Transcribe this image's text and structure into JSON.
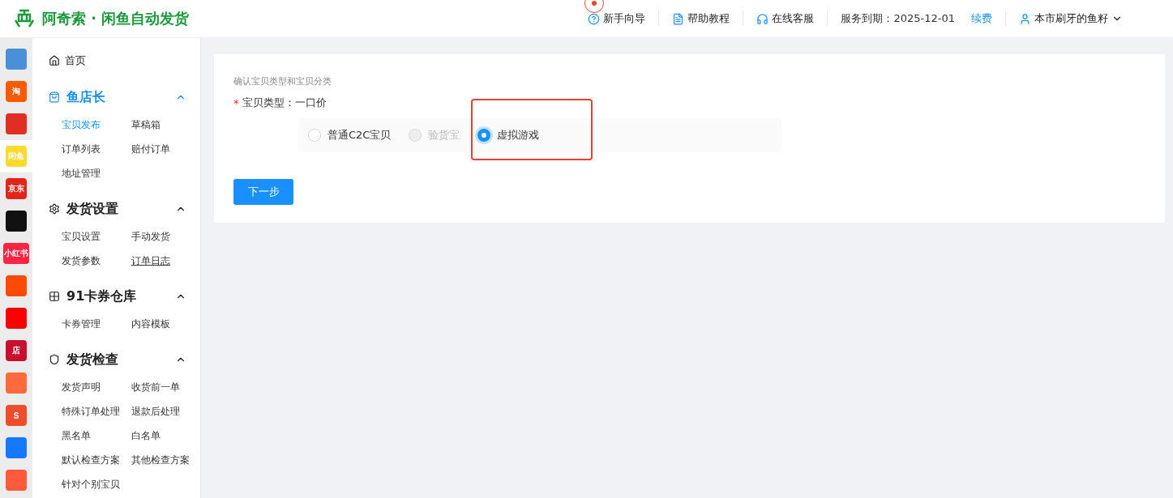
{
  "header": {
    "brand": "阿奇索 · 闲鱼自动发货",
    "links": [
      {
        "kind": "guide",
        "label": "新手向导"
      },
      {
        "kind": "doc",
        "label": "帮助教程"
      },
      {
        "kind": "support",
        "label": "在线客服"
      }
    ],
    "expiry": "服务到期：2025-12-01",
    "renew": "续费",
    "user": "本市刷牙的鱼籽"
  },
  "platforms": [
    {
      "color": "#4a90d9",
      "selected": false
    },
    {
      "label": "淘",
      "color": "#ff5a00",
      "selected": false
    },
    {
      "color": "#e02e24",
      "selected": false
    },
    {
      "label": "闲鱼",
      "color": "#ffd92e",
      "selected": true
    },
    {
      "label": "京东",
      "color": "#e1251b",
      "selected": false
    },
    {
      "color": "#111111",
      "selected": false
    },
    {
      "label": "小红书",
      "color": "#ff2442",
      "selected": false
    },
    {
      "color": "#ff4906",
      "selected": false
    },
    {
      "color": "#ff0000",
      "selected": false
    },
    {
      "label": "店",
      "color": "#c8102e",
      "selected": false
    },
    {
      "color": "#ff6a3d",
      "selected": false
    },
    {
      "label": "S",
      "color": "#ee4d2d",
      "selected": false
    },
    {
      "color": "#1677ff",
      "selected": false
    },
    {
      "color": "#ff5a3c",
      "selected": false
    }
  ],
  "sidebar": {
    "home": "首页",
    "groups": [
      {
        "kind": "bag",
        "title": "鱼店长",
        "active": true,
        "expanded": true,
        "items": [
          {
            "label": "宝贝发布",
            "selected": true,
            "underlined": false
          },
          {
            "label": "草稿箱",
            "selected": false,
            "underlined": false
          },
          {
            "label": "订单列表",
            "selected": false,
            "underlined": false
          },
          {
            "label": "赔付订单",
            "selected": false,
            "underlined": false
          },
          {
            "label": "地址管理",
            "selected": false,
            "underlined": false
          }
        ]
      },
      {
        "kind": "gear",
        "title": "发货设置",
        "active": false,
        "expanded": true,
        "items": [
          {
            "label": "宝贝设置",
            "selected": false,
            "underlined": false
          },
          {
            "label": "手动发货",
            "selected": false,
            "underlined": false
          },
          {
            "label": "发货参数",
            "selected": false,
            "underlined": false
          },
          {
            "label": "订单日志",
            "selected": false,
            "underlined": true
          }
        ]
      },
      {
        "kind": "grid",
        "title": "91卡券仓库",
        "active": false,
        "expanded": true,
        "items": [
          {
            "label": "卡券管理",
            "selected": false,
            "underlined": false
          },
          {
            "label": "内容模板",
            "selected": false,
            "underlined": false
          }
        ]
      },
      {
        "kind": "shield",
        "title": "发货检查",
        "active": false,
        "expanded": true,
        "items": [
          {
            "label": "发货声明",
            "selected": false,
            "underlined": false
          },
          {
            "label": "收货前一单",
            "selected": false,
            "underlined": false
          },
          {
            "label": "特殊订单处理",
            "selected": false,
            "underlined": false
          },
          {
            "label": "退款后处理",
            "selected": false,
            "underlined": false
          },
          {
            "label": "黑名单",
            "selected": false,
            "underlined": false
          },
          {
            "label": "白名单",
            "selected": false,
            "underlined": false
          },
          {
            "label": "默认检查方案",
            "selected": false,
            "underlined": false
          },
          {
            "label": "其他检查方案",
            "selected": false,
            "underlined": false
          },
          {
            "label": "针对个别宝贝",
            "selected": false,
            "underlined": false
          }
        ]
      }
    ]
  },
  "form": {
    "hint": "确认宝贝类型和宝贝分类",
    "required_mark": "*",
    "type_label": "宝贝类型：",
    "type_value": "一口价",
    "options": [
      {
        "label": "普通C2C宝贝",
        "selected": false,
        "disabled": false
      },
      {
        "label": "验货宝",
        "selected": false,
        "disabled": true
      },
      {
        "label": "虚拟游戏",
        "selected": true,
        "disabled": false
      }
    ],
    "next": "下一步"
  }
}
